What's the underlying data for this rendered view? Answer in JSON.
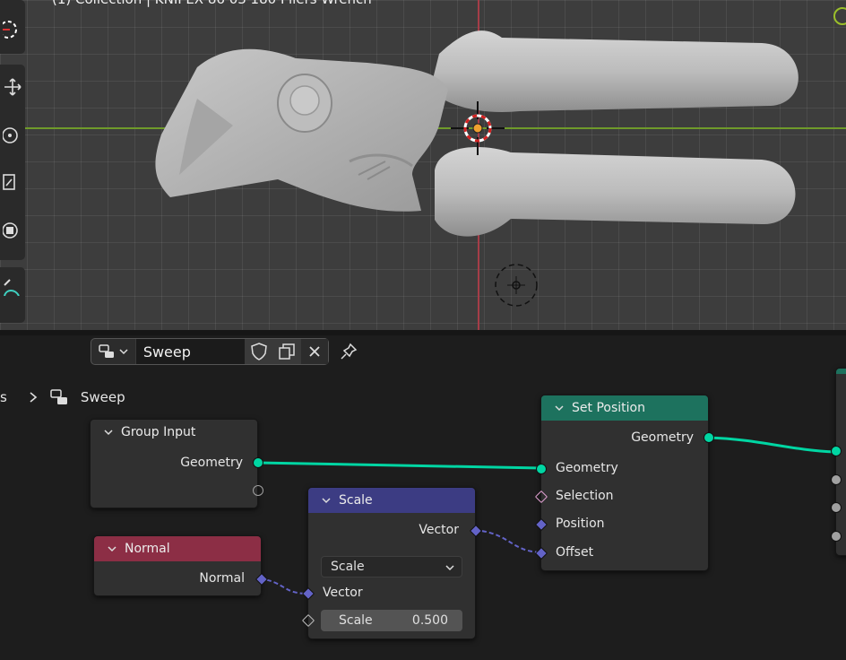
{
  "viewport": {
    "title": "(1) Collection | KNIPEX 86 03 180 Pliers Wrench"
  },
  "header": {
    "nodegroup_name": "Sweep",
    "fake_user_icon": "shield-icon",
    "duplicate_icon": "duplicate-icon",
    "unlink_icon": "close-icon",
    "pin_icon": "pin-icon"
  },
  "breadcrumb": {
    "parent_label": "s",
    "current_label": "Sweep"
  },
  "nodes": {
    "group_input": {
      "title": "Group Input",
      "output_geometry": "Geometry"
    },
    "normal": {
      "title": "Normal",
      "output_normal": "Normal",
      "color": "#8c2e45"
    },
    "scale": {
      "title": "Scale",
      "output_vector": "Vector",
      "operation": "Scale",
      "input_vector": "Vector",
      "scale_label": "Scale",
      "scale_value": "0.500",
      "color": "#3c3c83"
    },
    "set_position": {
      "title": "Set Position",
      "output_geometry": "Geometry",
      "input_geometry": "Geometry",
      "input_selection": "Selection",
      "input_position": "Position",
      "input_offset": "Offset",
      "color": "#1d725e"
    }
  },
  "colors": {
    "geometry_socket": "#00d6a3",
    "vector_socket": "#6363c7",
    "x_axis": "#6f9a2a",
    "y_axis": "#a53d48"
  }
}
